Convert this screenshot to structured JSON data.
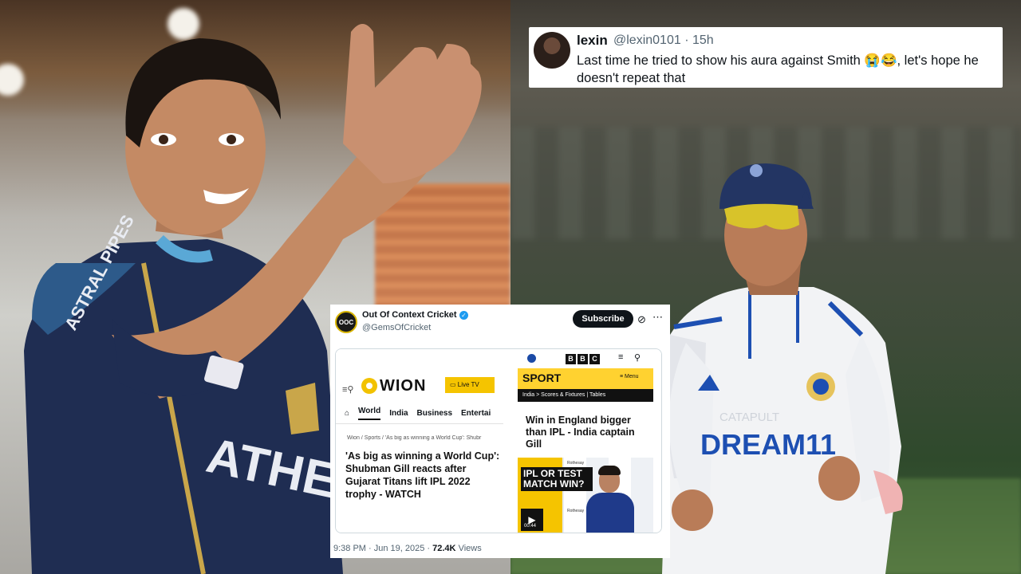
{
  "tweet": {
    "display_name": "lexin",
    "meta": "@lexin0101 · 15h",
    "text": "Last time he tried to show his aura against Smith 😭😂, let's hope he doesn't repeat that"
  },
  "post": {
    "avatar_text": "OOC",
    "display_name": "Out Of Context Cricket",
    "handle": "@GemsOfCricket",
    "subscribe_label": "Subscribe",
    "timestamp": "9:38 PM · Jun 19, 2025 ·",
    "views_count": "72.4K",
    "views_label": "Views",
    "wion": {
      "logo": "WION",
      "live_tv": "Live TV",
      "nav": [
        "World",
        "India",
        "Business",
        "Entertai"
      ],
      "breadcrumb": "Wion / Sports / 'As big as winning a World Cup': Shubr",
      "headline": "'As big as winning a World Cup': Shubman Gill reacts after Gujarat Titans lift IPL 2022 trophy - WATCH"
    },
    "bbc": {
      "logo_letters": [
        "B",
        "B",
        "C"
      ],
      "section": "SPORT",
      "menu_label": "≡ Menu",
      "subnav": "India  >  Scores & Fixtures  |  Tables",
      "headline": "Win in England bigger than IPL - India captain Gill",
      "video_text": "IPL OR TEST MATCH WIN?",
      "video_duration": "00:44",
      "sponsor": "Rothesay"
    }
  },
  "photos": {
    "left_jersey_text": "ATHE",
    "left_sponsor": "ASTRAL PIPES",
    "right_jersey_text": "DREAM11",
    "right_sponsor": "CATAPULT"
  }
}
